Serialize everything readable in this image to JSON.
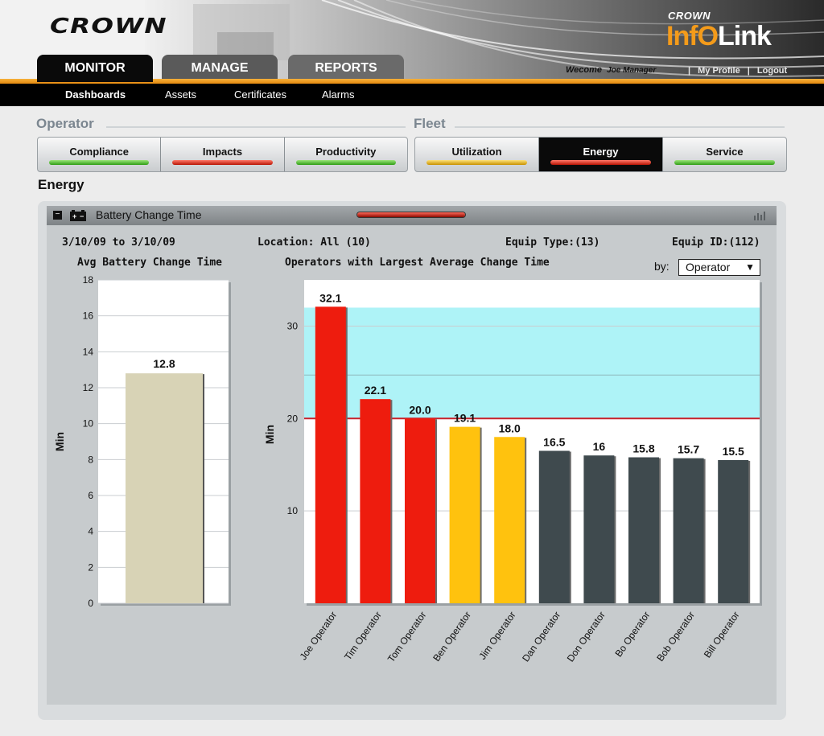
{
  "header": {
    "logo": "CROWN",
    "brand_small": "CROWN",
    "brand_info": "Inf",
    "brand_o": "O",
    "brand_link": "Link",
    "welcome_label": "Wecome",
    "user_name": "Joe Manager",
    "sep1": "|",
    "my_profile": "My Profile",
    "sep2": "|",
    "logout": "Logout"
  },
  "main_tabs": [
    {
      "label": "MONITOR",
      "active": true
    },
    {
      "label": "MANAGE",
      "active": false
    },
    {
      "label": "REPORTS",
      "active": false
    }
  ],
  "subnav": [
    {
      "label": "Dashboards",
      "active": true
    },
    {
      "label": "Assets",
      "active": false
    },
    {
      "label": "Certificates",
      "active": false
    },
    {
      "label": "Alarms",
      "active": false
    }
  ],
  "operator_section": {
    "title": "Operator",
    "tabs": [
      {
        "label": "Compliance",
        "status": "green"
      },
      {
        "label": "Impacts",
        "status": "red"
      },
      {
        "label": "Productivity",
        "status": "green"
      }
    ]
  },
  "fleet_section": {
    "title": "Fleet",
    "tabs": [
      {
        "label": "Utilization",
        "status": "yellow"
      },
      {
        "label": "Energy",
        "status": "red",
        "active": true
      },
      {
        "label": "Service",
        "status": "green"
      }
    ]
  },
  "page_heading": "Energy",
  "panel": {
    "title": "Battery Change Time",
    "date_range": "3/10/09 to 3/10/09",
    "location": "Location: All (10)",
    "equip_type": "Equip Type:(13)",
    "equip_id": "Equip ID:(112)",
    "by_label": "by:",
    "by_value": "Operator",
    "caret": "▼"
  },
  "colors": {
    "accent_orange": "#f49b1a",
    "red": "#ee1c0e",
    "yellow": "#ffc20e",
    "dark": "#3f4a4e",
    "khaki": "#d8d3b6",
    "band": "#aef3f7",
    "threshold": "#c8202a"
  },
  "chart_data": [
    {
      "type": "bar",
      "title": "Avg Battery Change Time",
      "ylabel": "Min",
      "ylim": [
        0,
        18
      ],
      "yticks": [
        "0",
        "2",
        "4",
        "6",
        "8",
        "10",
        "12",
        "14",
        "16",
        "18"
      ],
      "grid": true,
      "categories": [
        ""
      ],
      "values": [
        12.8
      ],
      "labels": [
        "12.8"
      ]
    },
    {
      "type": "bar",
      "title": "Operators with Largest Average Change Time",
      "ylabel": "Min",
      "ylim": [
        0,
        35
      ],
      "yticks": [
        "10",
        "20",
        "30"
      ],
      "grid": true,
      "categories": [
        "Joe Operator",
        "Tim Operator",
        "Tom Operator",
        "Ben Operator",
        "Jim Operator",
        "Dan Operator",
        "Don Operator",
        "Bo Operator",
        "Bob Operator",
        "Bill Operator"
      ],
      "values": [
        32.1,
        22.1,
        20.0,
        19.1,
        18.0,
        16.5,
        16,
        15.8,
        15.7,
        15.5
      ],
      "labels": [
        "32.1",
        "22.1",
        "20.0",
        "19.1",
        "18.0",
        "16.5",
        "16",
        "15.8",
        "15.7",
        "15.5"
      ],
      "bar_status": [
        "red",
        "red",
        "red",
        "yellow",
        "yellow",
        "dark",
        "dark",
        "dark",
        "dark",
        "dark"
      ],
      "threshold": 20,
      "band": [
        20,
        32
      ],
      "band_mid": 24.7
    }
  ]
}
